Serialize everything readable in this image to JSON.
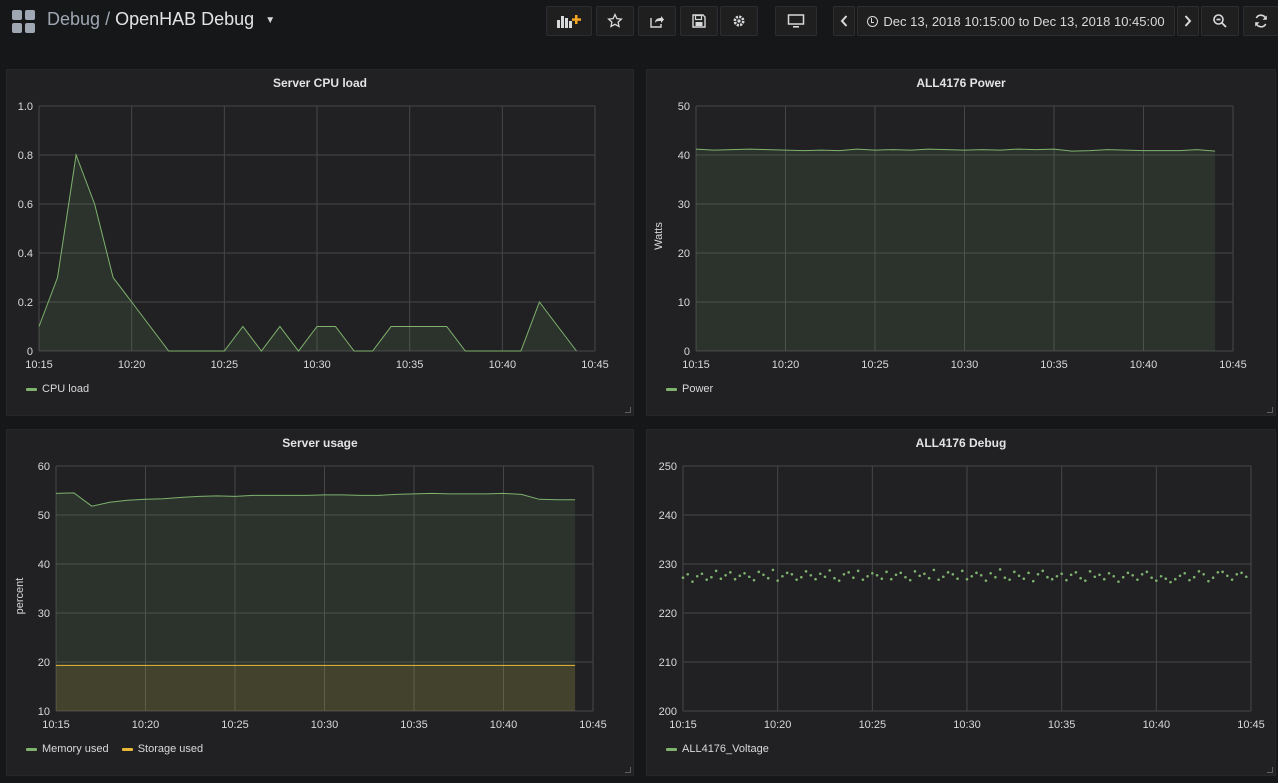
{
  "header": {
    "folder": "Debug",
    "separator": "/",
    "dashboard": "OpenHAB Debug",
    "time_range": "Dec 13, 2018 10:15:00 to Dec 13, 2018 10:45:00",
    "icons": [
      "add-panel-icon",
      "star-icon",
      "share-icon",
      "save-icon",
      "settings-icon",
      "tv-mode-icon",
      "chevron-left-icon",
      "clock-icon",
      "chevron-right-icon",
      "zoom-out-icon",
      "refresh-icon"
    ]
  },
  "colors": {
    "green": "#7eb26d",
    "yellow": "#eab839",
    "background": "#161719",
    "panel": "#212124"
  },
  "panels": [
    {
      "title": "Server CPU load",
      "y_axis_label": "",
      "legend": [
        {
          "name": "CPU load",
          "color": "#7eb26d"
        }
      ],
      "chart_data": {
        "type": "area",
        "title": "Server CPU load",
        "x_ticks": [
          "10:15",
          "10:20",
          "10:25",
          "10:30",
          "10:35",
          "10:40",
          "10:45"
        ],
        "y_ticks": [
          "0",
          "0.2",
          "0.4",
          "0.6",
          "0.8",
          "1.0"
        ],
        "xlim": [
          0,
          30
        ],
        "ylim": [
          0,
          1.0
        ],
        "grid": true,
        "series": [
          {
            "name": "CPU load",
            "style": "area",
            "color": "#7eb26d",
            "x": [
              0,
              1,
              2,
              3,
              4,
              5,
              6,
              7,
              8,
              9,
              10,
              11,
              12,
              13,
              14,
              15,
              16,
              17,
              18,
              19,
              20,
              21,
              22,
              23,
              24,
              25,
              26,
              27,
              28,
              29
            ],
            "y": [
              0.1,
              0.3,
              0.8,
              0.6,
              0.3,
              0.2,
              0.1,
              0,
              0,
              0,
              0,
              0.1,
              0,
              0.1,
              0,
              0.1,
              0.1,
              0,
              0,
              0.1,
              0.1,
              0.1,
              0.1,
              0,
              0,
              0,
              0,
              0.2,
              0.1,
              0
            ]
          }
        ]
      }
    },
    {
      "title": "ALL4176 Power",
      "y_axis_label": "Watts",
      "legend": [
        {
          "name": "Power",
          "color": "#7eb26d"
        }
      ],
      "chart_data": {
        "type": "area",
        "title": "ALL4176 Power",
        "ylabel": "Watts",
        "x_ticks": [
          "10:15",
          "10:20",
          "10:25",
          "10:30",
          "10:35",
          "10:40",
          "10:45"
        ],
        "y_ticks": [
          "0",
          "10",
          "20",
          "30",
          "40",
          "50"
        ],
        "xlim": [
          0,
          30
        ],
        "ylim": [
          0,
          50
        ],
        "grid": true,
        "series": [
          {
            "name": "Power",
            "style": "area",
            "color": "#7eb26d",
            "x": [
              0,
              1,
              2,
              3,
              4,
              5,
              6,
              7,
              8,
              9,
              10,
              11,
              12,
              13,
              14,
              15,
              16,
              17,
              18,
              19,
              20,
              21,
              22,
              23,
              24,
              25,
              26,
              27,
              28,
              29
            ],
            "y": [
              41.2,
              41.0,
              41.1,
              41.2,
              41.1,
              41.0,
              40.9,
              41.0,
              40.9,
              41.2,
              41.0,
              41.1,
              41.0,
              41.2,
              41.1,
              41.0,
              41.1,
              41.0,
              41.2,
              41.1,
              41.2,
              40.8,
              40.9,
              41.1,
              41.0,
              40.9,
              40.9,
              40.9,
              41.1,
              40.8
            ]
          }
        ]
      }
    },
    {
      "title": "Server usage",
      "y_axis_label": "percent",
      "legend": [
        {
          "name": "Memory used",
          "color": "#7eb26d"
        },
        {
          "name": "Storage used",
          "color": "#eab839"
        }
      ],
      "chart_data": {
        "type": "area",
        "title": "Server usage",
        "ylabel": "percent",
        "x_ticks": [
          "10:15",
          "10:20",
          "10:25",
          "10:30",
          "10:35",
          "10:40",
          "10:45"
        ],
        "y_ticks": [
          "10",
          "20",
          "30",
          "40",
          "50",
          "60"
        ],
        "xlim": [
          0,
          30
        ],
        "ylim": [
          10,
          60
        ],
        "grid": true,
        "series": [
          {
            "name": "Memory used",
            "style": "area",
            "color": "#7eb26d",
            "x": [
              0,
              1,
              2,
              3,
              4,
              5,
              6,
              7,
              8,
              9,
              10,
              11,
              12,
              13,
              14,
              15,
              16,
              17,
              18,
              19,
              20,
              21,
              22,
              23,
              24,
              25,
              26,
              27,
              28,
              29
            ],
            "y": [
              54.4,
              54.5,
              51.8,
              52.6,
              53.0,
              53.2,
              53.3,
              53.6,
              53.8,
              53.9,
              53.8,
              54.0,
              54.0,
              54.0,
              54.0,
              54.1,
              54.1,
              54.0,
              54.0,
              54.2,
              54.3,
              54.4,
              54.3,
              54.3,
              54.3,
              54.4,
              54.2,
              53.2,
              53.1,
              53.1
            ]
          },
          {
            "name": "Storage used",
            "style": "area",
            "color": "#eab839",
            "x": [
              0,
              29
            ],
            "y": [
              19.3,
              19.3
            ]
          }
        ]
      }
    },
    {
      "title": "ALL4176 Debug",
      "y_axis_label": "",
      "legend": [
        {
          "name": "ALL4176_Voltage",
          "color": "#7eb26d"
        }
      ],
      "chart_data": {
        "type": "scatter",
        "title": "ALL4176 Debug",
        "x_ticks": [
          "10:15",
          "10:20",
          "10:25",
          "10:30",
          "10:35",
          "10:40",
          "10:45"
        ],
        "y_ticks": [
          "200",
          "210",
          "220",
          "230",
          "240",
          "250"
        ],
        "xlim": [
          0,
          30
        ],
        "ylim": [
          200,
          250
        ],
        "grid": true,
        "series": [
          {
            "name": "ALL4176_Voltage",
            "style": "points",
            "color": "#7eb26d",
            "x": [
              0,
              0.25,
              0.5,
              0.75,
              1,
              1.25,
              1.5,
              1.75,
              2,
              2.25,
              2.5,
              2.75,
              3,
              3.25,
              3.5,
              3.75,
              4,
              4.25,
              4.5,
              4.75,
              5,
              5.25,
              5.5,
              5.75,
              6,
              6.25,
              6.5,
              6.75,
              7,
              7.25,
              7.5,
              7.75,
              8,
              8.25,
              8.5,
              8.75,
              9,
              9.25,
              9.5,
              9.75,
              10,
              10.25,
              10.5,
              10.75,
              11,
              11.25,
              11.5,
              11.75,
              12,
              12.25,
              12.5,
              12.75,
              13,
              13.25,
              13.5,
              13.75,
              14,
              14.25,
              14.5,
              14.75,
              15,
              15.25,
              15.5,
              15.75,
              16,
              16.25,
              16.5,
              16.75,
              17,
              17.25,
              17.5,
              17.75,
              18,
              18.25,
              18.5,
              18.75,
              19,
              19.25,
              19.5,
              19.75,
              20,
              20.25,
              20.5,
              20.75,
              21,
              21.25,
              21.5,
              21.75,
              22,
              22.25,
              22.5,
              22.75,
              23,
              23.25,
              23.5,
              23.75,
              24,
              24.25,
              24.5,
              24.75,
              25,
              25.25,
              25.5,
              25.75,
              26,
              26.25,
              26.5,
              26.75,
              27,
              27.25,
              27.5,
              27.75,
              28,
              28.25,
              28.5,
              28.75,
              29,
              29.25,
              29.5,
              29.75
            ],
            "y": [
              227.2,
              227.9,
              226.4,
              227.5,
              228.0,
              226.8,
              227.3,
              228.6,
              227.0,
              227.7,
              228.3,
              226.9,
              227.6,
              228.1,
              227.4,
              226.7,
              228.4,
              227.8,
              227.1,
              228.8,
              226.6,
              227.5,
              228.2,
              227.9,
              226.8,
              227.3,
              228.5,
              227.7,
              226.9,
              228.0,
              227.4,
              228.7,
              227.1,
              226.6,
              227.9,
              228.3,
              227.2,
              228.6,
              226.8,
              227.5,
              228.1,
              227.7,
              227.0,
              228.4,
              226.9,
              227.8,
              228.2,
              227.3,
              226.7,
              228.5,
              227.6,
              228.0,
              227.1,
              228.8,
              226.8,
              227.4,
              228.3,
              227.9,
              227.0,
              228.6,
              226.9,
              227.5,
              228.2,
              227.7,
              226.6,
              228.1,
              227.3,
              228.9,
              227.2,
              226.8,
              228.4,
              227.6,
              227.0,
              228.2,
              226.5,
              227.9,
              228.6,
              227.3,
              226.9,
              227.5,
              228.0,
              226.7,
              227.8,
              228.3,
              227.1,
              226.6,
              228.5,
              227.4,
              227.8,
              226.9,
              228.1,
              227.5,
              226.4,
              227.3,
              228.2,
              227.7,
              226.8,
              227.9,
              228.4,
              227.2,
              226.6,
              227.5,
              227.0,
              226.3,
              226.9,
              227.6,
              228.1,
              226.7,
              227.3,
              228.5,
              227.9,
              226.5,
              227.2,
              228.3,
              228.4,
              227.6,
              226.8,
              227.9,
              228.2,
              227.4
            ]
          }
        ]
      }
    }
  ]
}
